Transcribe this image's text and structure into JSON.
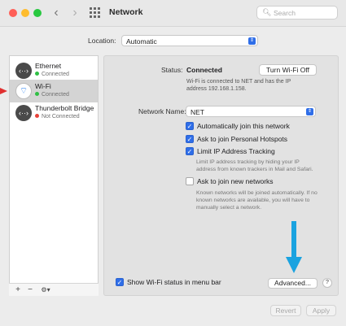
{
  "window": {
    "title": "Network"
  },
  "toolbar": {
    "search_placeholder": "Search",
    "back_icon": "‹",
    "forward_icon": "›"
  },
  "location": {
    "label": "Location:",
    "value": "Automatic"
  },
  "sidebar": {
    "items": [
      {
        "name": "Ethernet",
        "status": "Connected",
        "status_color": "#2fbf44",
        "icon": "ethernet-icon"
      },
      {
        "name": "Wi-Fi",
        "status": "Connected",
        "status_color": "#2fbf44",
        "icon": "wifi-icon"
      },
      {
        "name": "Thunderbolt Bridge",
        "status": "Not Connected",
        "status_color": "#e8423a",
        "icon": "thunderbolt-icon"
      }
    ],
    "tools": {
      "add": "+",
      "remove": "−",
      "gear": "⚙▾"
    }
  },
  "main": {
    "status_label": "Status:",
    "status_value": "Connected",
    "toggle_button": "Turn Wi-Fi Off",
    "status_desc_line1": "Wi-Fi is connected to NET and has the IP",
    "status_desc_line2": "address 192.168.1.158.",
    "network_name_label": "Network Name:",
    "network_name_value": "NET",
    "options": [
      {
        "label": "Automatically join this network",
        "checked": true
      },
      {
        "label": "Ask to join Personal Hotspots",
        "checked": true
      },
      {
        "label": "Limit IP Address Tracking",
        "checked": true
      },
      {
        "label": "Ask to join new networks",
        "checked": false
      }
    ],
    "limit_hint_line1": "Limit IP address tracking by hiding your IP",
    "limit_hint_line2": "address from known trackers in Mail and Safari.",
    "join_hint_line1": "Known networks will be joined automatically. If no",
    "join_hint_line2": "known networks are available, you will have to",
    "join_hint_line3": "manually select a network.",
    "show_status_label": "Show Wi-Fi status in menu bar",
    "show_status_checked": true,
    "advanced_button": "Advanced...",
    "help_button": "?"
  },
  "footer": {
    "revert_button": "Revert",
    "apply_button": "Apply"
  },
  "colors": {
    "accent": "#2f6ee8",
    "annotation_arrow": "#1aa3e0",
    "pointer": "#e03030"
  }
}
